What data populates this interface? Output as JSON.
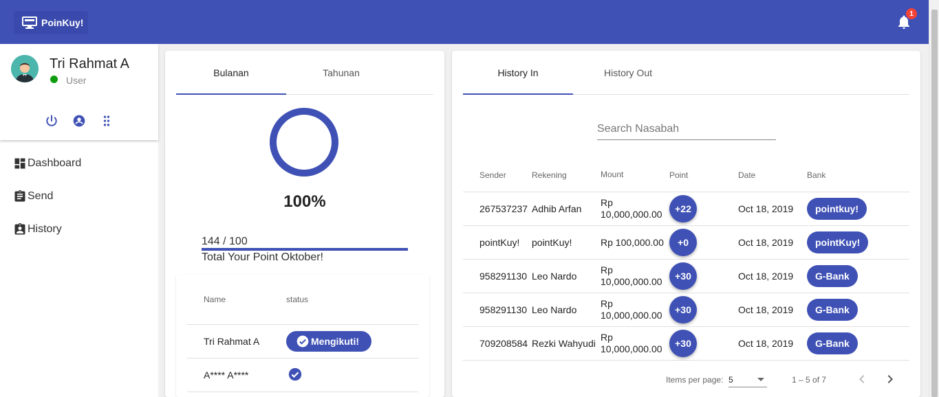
{
  "topbar": {
    "brand": "PoinKuy!",
    "notification_count": "1"
  },
  "profile": {
    "name": "Tri Rahmat A",
    "role": "User",
    "status_color": "#0f9d0f"
  },
  "nav": [
    {
      "label": "Dashboard",
      "icon": "dashboard-icon"
    },
    {
      "label": "Send",
      "icon": "clipboard-icon"
    },
    {
      "label": "History",
      "icon": "badge-icon"
    }
  ],
  "left_card": {
    "tabs": [
      "Bulanan",
      "Tahunan"
    ],
    "active_tab": 0,
    "percent": "100%",
    "progress_text": "144 / 100",
    "progress_fraction": 1.0,
    "caption": "Total Your Point Oktober!",
    "table": {
      "headers": [
        "Name",
        "status"
      ],
      "rows": [
        {
          "name": "Tri Rahmat A",
          "status": "Mengikuti!"
        },
        {
          "name": "A**** A****",
          "status": ""
        }
      ]
    }
  },
  "right_card": {
    "tabs": [
      "History In",
      "History Out"
    ],
    "active_tab": 0,
    "search_placeholder": "Search Nasabah",
    "headers": [
      "Sender",
      "Rekening",
      "Mount",
      "Point",
      "Date",
      "Bank"
    ],
    "rows": [
      {
        "sender": "267537237",
        "rekening": "Adhib Arfan",
        "mount": "Rp 10,000,000.00",
        "point": "+22",
        "date": "Oct 18, 2019",
        "bank": "pointkuy!"
      },
      {
        "sender": "pointKuy!",
        "rekening": "pointKuy!",
        "mount": "Rp 100,000.00",
        "point": "+0",
        "date": "Oct 18, 2019",
        "bank": "pointKuy!"
      },
      {
        "sender": "958291130",
        "rekening": "Leo Nardo",
        "mount": "Rp 10,000,000.00",
        "point": "+30",
        "date": "Oct 18, 2019",
        "bank": "G-Bank"
      },
      {
        "sender": "958291130",
        "rekening": "Leo Nardo",
        "mount": "Rp 10,000,000.00",
        "point": "+30",
        "date": "Oct 18, 2019",
        "bank": "G-Bank"
      },
      {
        "sender": "709208584",
        "rekening": "Rezki Wahyudi",
        "mount": "Rp 10,000,000.00",
        "point": "+30",
        "date": "Oct 18, 2019",
        "bank": "G-Bank"
      }
    ],
    "paginator": {
      "label": "Items per page:",
      "page_size": "5",
      "range": "1 – 5 of 7"
    }
  },
  "colors": {
    "primary": "#3f51b5",
    "badge": "#f44336"
  }
}
